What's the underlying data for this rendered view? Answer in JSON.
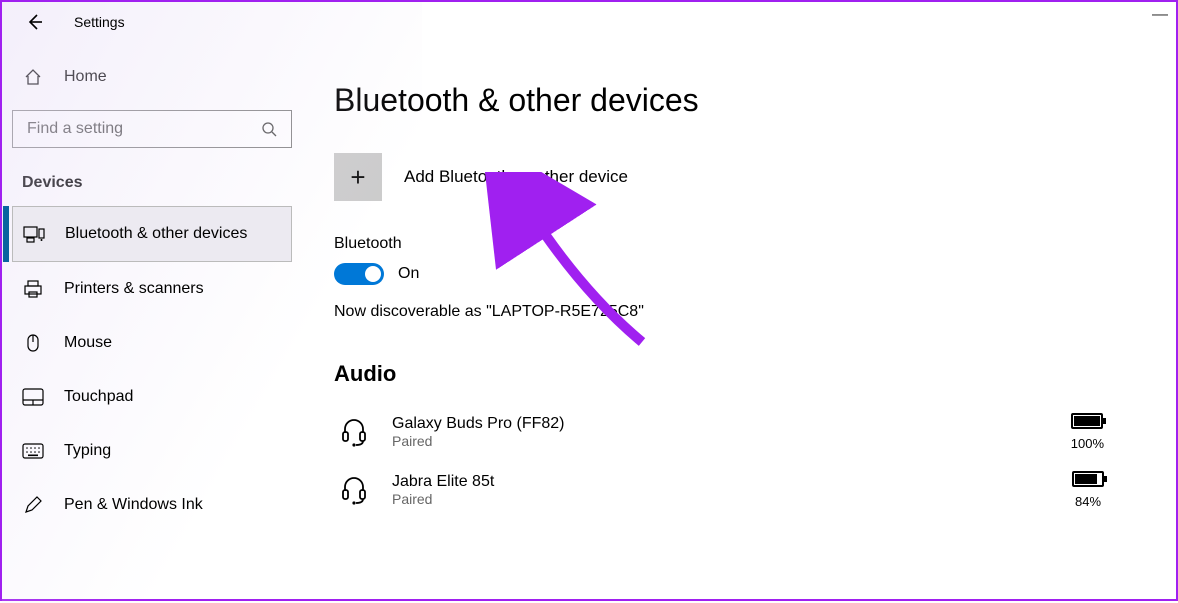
{
  "app_title": "Settings",
  "home_label": "Home",
  "search_placeholder": "Find a setting",
  "category": "Devices",
  "nav": [
    {
      "label": "Bluetooth & other devices",
      "active": true,
      "icon": "bluetooth-devices"
    },
    {
      "label": "Printers & scanners",
      "active": false,
      "icon": "printer"
    },
    {
      "label": "Mouse",
      "active": false,
      "icon": "mouse"
    },
    {
      "label": "Touchpad",
      "active": false,
      "icon": "touchpad"
    },
    {
      "label": "Typing",
      "active": false,
      "icon": "keyboard"
    },
    {
      "label": "Pen & Windows Ink",
      "active": false,
      "icon": "pen"
    }
  ],
  "page_title": "Bluetooth & other devices",
  "add_label": "Add Bluetooth or other device",
  "bt_label": "Bluetooth",
  "toggle_state": "On",
  "discover_text": "Now discoverable as \"LAPTOP-R5E725C8\"",
  "audio_heading": "Audio",
  "devices": [
    {
      "name": "Galaxy Buds Pro (FF82)",
      "status": "Paired",
      "battery": "100%",
      "fill": 100
    },
    {
      "name": "Jabra Elite 85t",
      "status": "Paired",
      "battery": "84%",
      "fill": 84
    }
  ]
}
